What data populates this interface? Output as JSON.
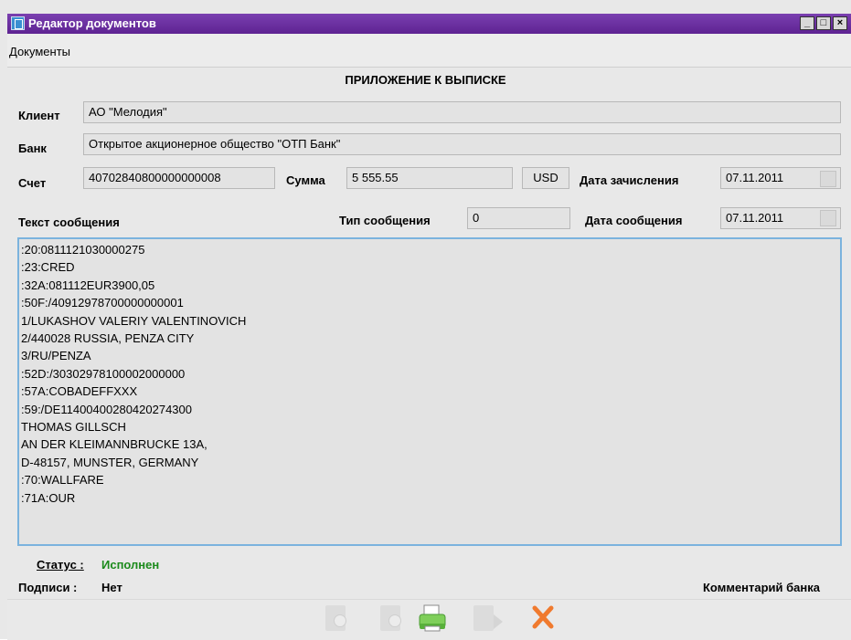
{
  "window": {
    "title": "Редактор документов"
  },
  "menu": {
    "items": [
      "Документы"
    ]
  },
  "form": {
    "heading": "ПРИЛОЖЕНИЕ К ВЫПИСКЕ",
    "client_label": "Клиент",
    "client_value": "АО \"Мелодия\"",
    "bank_label": "Банк",
    "bank_value": "Открытое акционерное общество \"ОТП Банк\"",
    "account_label": "Счет",
    "account_value": "40702840800000000008",
    "amount_label": "Сумма",
    "amount_value": "5 555.55",
    "currency_value": "USD",
    "credit_date_label": "Дата зачисления",
    "credit_date_value": "07.11.2011",
    "message_text_label": "Текст сообщения",
    "message_type_label": "Тип сообщения",
    "message_type_value": "0",
    "message_date_label": "Дата сообщения",
    "message_date_value": "07.11.2011",
    "message_lines": [
      ":20:0811121030000275",
      ":23:CRED",
      ":32A:081112EUR3900,05",
      ":50F:/40912978700000000001",
      "1/LUKASHOV VALERIY VALENTINOVICH",
      "2/440028 RUSSIA, PENZA CITY",
      "3/RU/PENZA",
      ":52D:/30302978100002000000",
      ":57A:COBADEFFXXX",
      ":59:/DE11400400280420274300",
      "THOMAS GILLSCH",
      "AN DER KLEIMANNBRUCKE 13A,",
      "D-48157, MUNSTER, GERMANY",
      ":70:WALLFARE",
      ":71A:OUR"
    ],
    "status_label": "Статус :",
    "status_value": "Исполнен",
    "signatures_label": "Подписи :",
    "signatures_value": "Нет",
    "bank_comment_label": "Комментарий банка"
  },
  "colors": {
    "title_bar": "#6a2aa0",
    "status": "#1b8a1b",
    "delete": "#f07a2e",
    "textarea_border": "#7bb3de"
  },
  "toolbar": {
    "icons": [
      "sign-icon",
      "remove-sign-icon",
      "print-icon",
      "export-icon",
      "delete-icon"
    ]
  }
}
